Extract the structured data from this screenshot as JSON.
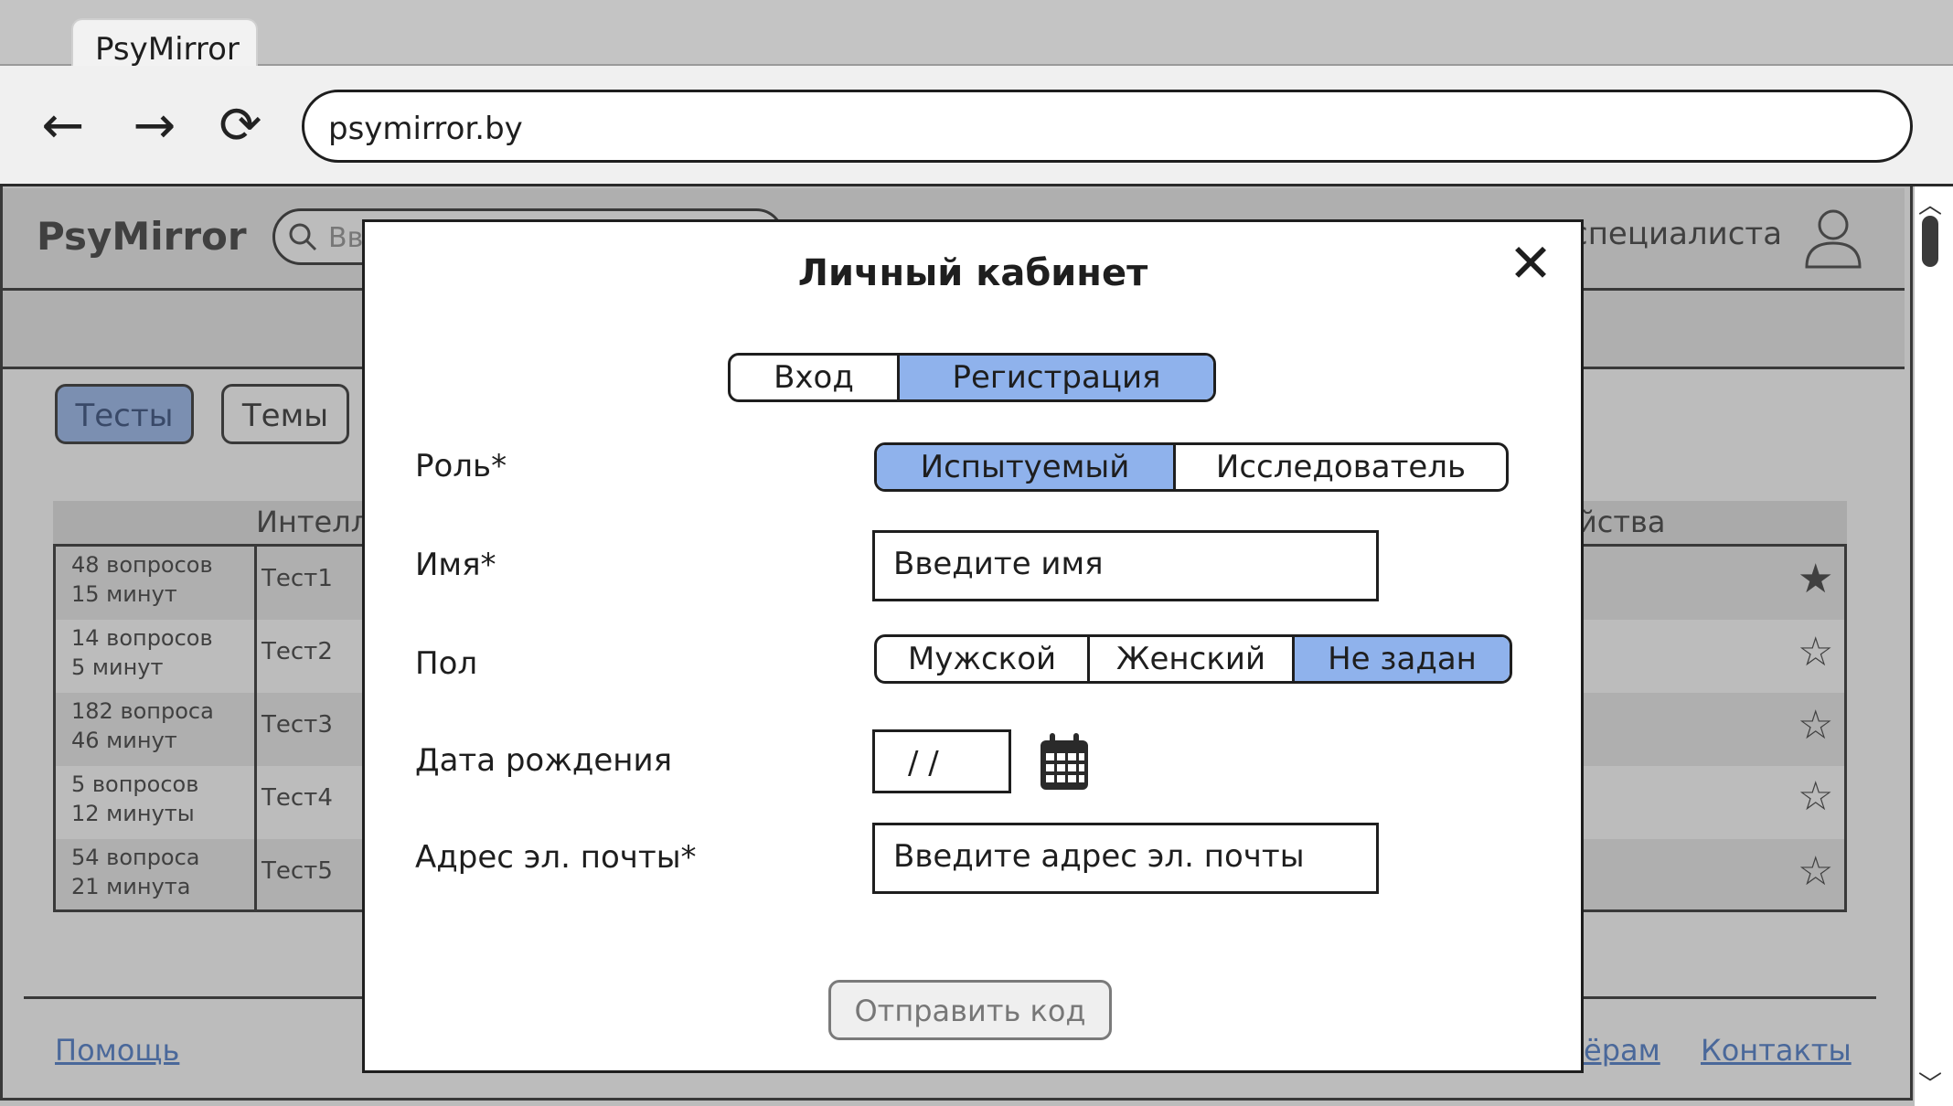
{
  "browser": {
    "tab_title": "PsyMirror",
    "url": "psymirror.by",
    "back_glyph": "←",
    "forward_glyph": "→",
    "reload_glyph": "⟳"
  },
  "app": {
    "logo": "PsyMirror",
    "search_placeholder": "Вв",
    "specialist_text": "специалиста",
    "nav_tabs": [
      "Тесты",
      "Темы"
    ],
    "table_header_left": "Интелл",
    "table_header_right": "йства",
    "rows": [
      {
        "info1": "48 вопросов",
        "info2": "15 минут",
        "name": "Тест1",
        "favorite": true
      },
      {
        "info1": "14 вопросов",
        "info2": "5 минут",
        "name": "Тест2",
        "favorite": false
      },
      {
        "info1": "182 вопроса",
        "info2": "46 минут",
        "name": "Тест3",
        "favorite": false
      },
      {
        "info1": "5 вопросов",
        "info2": "12 минуты",
        "name": "Тест4",
        "favorite": false
      },
      {
        "info1": "54 вопроса",
        "info2": "21 минута",
        "name": "Тест5",
        "favorite": false
      }
    ],
    "footer": {
      "help": "Помощь",
      "partners": "ёрам",
      "contacts": "Контакты"
    }
  },
  "modal": {
    "title": "Личный кабинет",
    "close_glyph": "✕",
    "auth_tabs": [
      "Вход",
      "Регистрация"
    ],
    "auth_active": "Регистрация",
    "role_label": "Роль*",
    "roles": [
      "Испытуемый",
      "Исследователь"
    ],
    "role_active": "Испытуемый",
    "name_label": "Имя*",
    "name_placeholder": "Введите имя",
    "gender_label": "Пол",
    "genders": [
      "Мужской",
      "Женский",
      "Не задан"
    ],
    "gender_active": "Не задан",
    "birth_label": "Дата рождения",
    "birth_placeholder": "/ /",
    "email_label": "Адрес эл. почты*",
    "email_placeholder": "Введите адрес эл. почты",
    "submit_label": "Отправить код"
  },
  "colors": {
    "accent": "#8fb2ec",
    "link": "#3b6fc4"
  }
}
